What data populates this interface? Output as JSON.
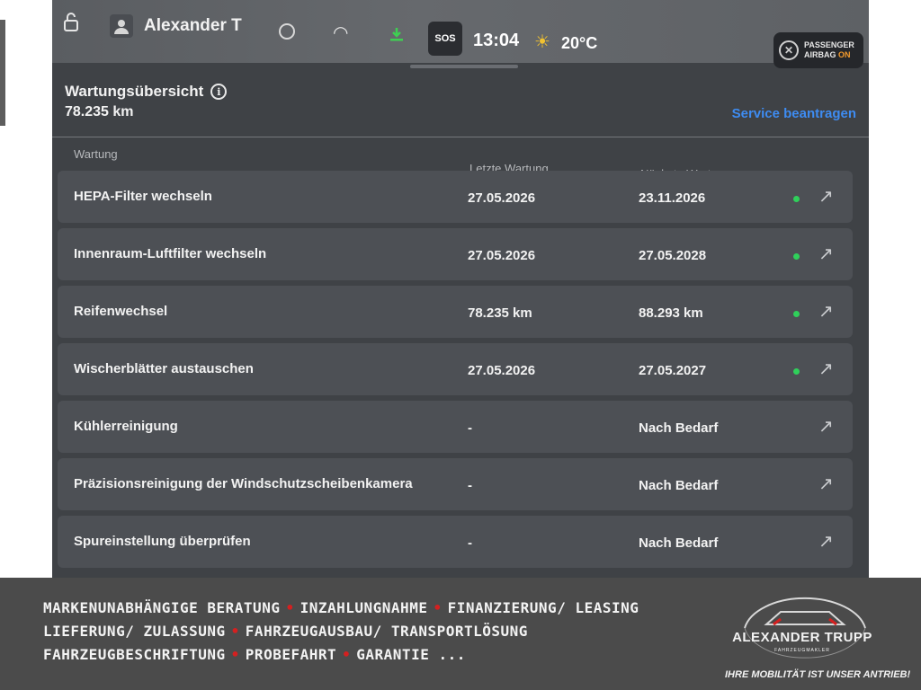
{
  "status_bar": {
    "user_name": "Alexander T",
    "sos_label": "SOS",
    "time": "13:04",
    "temperature": "20°C",
    "airbag_label": "PASSENGER",
    "airbag_label2": "AIRBAG",
    "airbag_state": "ON",
    "icons": [
      "lock-icon",
      "user-icon",
      "circle-icon",
      "wifi-icon",
      "download-icon",
      "sos-icon",
      "sun-icon",
      "airbag-off-icon"
    ],
    "airbag_on_color": "#f39a2c"
  },
  "header": {
    "title": "Wartungsübersicht",
    "odometer": "78.235 km",
    "service_link": "Service beantragen"
  },
  "table": {
    "columns": {
      "name": "Wartung",
      "last": "Letzte Wartung",
      "next": "Nächste Wartung"
    },
    "rows": [
      {
        "name": "HEPA-Filter wechseln",
        "last": "27.05.2026",
        "next": "23.11.2026",
        "status": "ok"
      },
      {
        "name": "Innenraum-Luftfilter wechseln",
        "last": "27.05.2026",
        "next": "27.05.2028",
        "status": "ok"
      },
      {
        "name": "Reifenwechsel",
        "last": "78.235 km",
        "next": "88.293 km",
        "status": "ok"
      },
      {
        "name": "Wischerblätter austauschen",
        "last": "27.05.2026",
        "next": "27.05.2027",
        "status": "ok"
      },
      {
        "name": "Kühlerreinigung",
        "last": "-",
        "next": "Nach Bedarf",
        "status": "none"
      },
      {
        "name": "Präzisionsreinigung der Windschutzscheibenkamera",
        "last": "-",
        "next": "Nach Bedarf",
        "status": "none"
      },
      {
        "name": "Spureinstellung überprüfen",
        "last": "-",
        "next": "Nach Bedarf",
        "status": "none"
      }
    ],
    "status_color": "#2fd05a",
    "row_icon": "arrow-up-right-icon"
  },
  "banner": {
    "line1": [
      "MARKENUNABHÄNGIGE BERATUNG",
      "INZAHLUNGNAHME",
      "FINANZIERUNG/ LEASING"
    ],
    "line2": [
      "LIEFERUNG/ ZULASSUNG",
      "FAHRZEUGAUSBAU/ TRANSPORTLÖSUNG"
    ],
    "line3": [
      "FAHRZEUGBESCHRIFTUNG",
      "PROBEFAHRT",
      "GARANTIE ..."
    ],
    "separator_color": "#d42020",
    "logo_name": "ALEXANDER TRUPP",
    "logo_sub": "FAHRZEUGMAKLER",
    "tagline": "IHRE MOBILITÄT IST UNSER ANTRIEB!"
  }
}
